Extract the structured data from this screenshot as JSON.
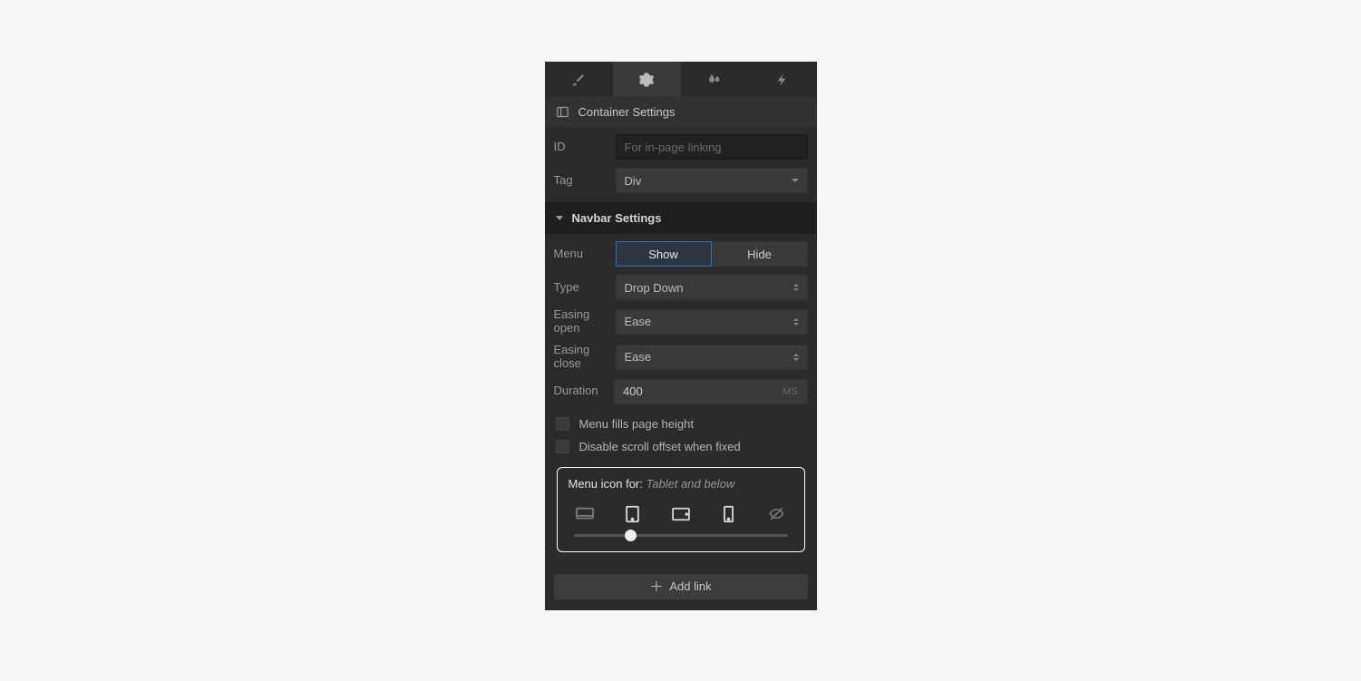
{
  "tabs": [
    "brush",
    "gear",
    "droplets",
    "bolt"
  ],
  "containerSettings": {
    "title": "Container Settings",
    "idLabel": "ID",
    "idPlaceholder": "For in-page linking",
    "idValue": "",
    "tagLabel": "Tag",
    "tagValue": "Div"
  },
  "navbarSettings": {
    "title": "Navbar Settings",
    "menuLabel": "Menu",
    "menuShow": "Show",
    "menuHide": "Hide",
    "typeLabel": "Type",
    "typeValue": "Drop Down",
    "easingOpenLabel": "Easing open",
    "easingOpenValue": "Ease",
    "easingCloseLabel": "Easing close",
    "easingCloseValue": "Ease",
    "durationLabel": "Duration",
    "durationValue": "400",
    "durationUnit": "MS",
    "chkFills": "Menu fills page height",
    "chkDisable": "Disable scroll offset when fixed",
    "menuIconForLabel": "Menu icon for:",
    "menuIconForValue": "Tablet and below",
    "sliderPercent": 24,
    "addLinkLabel": "Add link"
  }
}
